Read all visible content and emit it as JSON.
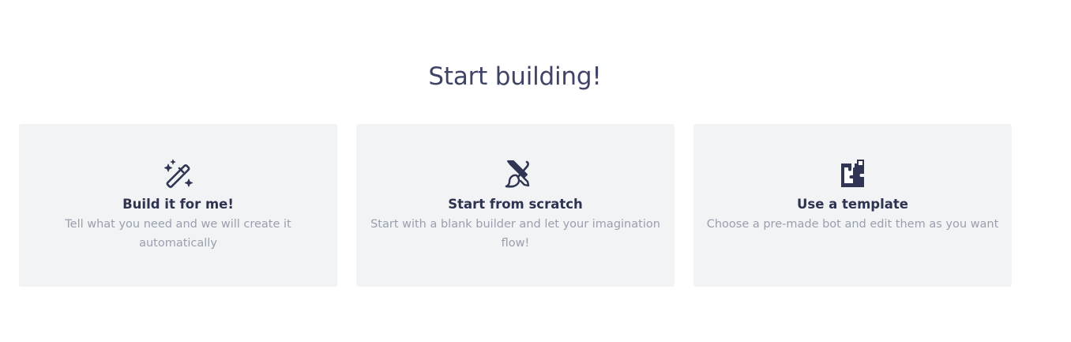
{
  "heading": "Start building!",
  "colors": {
    "heading": "#3f4466",
    "card_background": "#f2f3f5",
    "card_title": "#2e3450",
    "card_description": "#9a9fae",
    "icon": "#2f3552"
  },
  "cards": [
    {
      "icon": "magic-wand-sparkles-icon",
      "title": "Build it for me!",
      "description": "Tell what you need and we will create it automatically"
    },
    {
      "icon": "pencil-paintbrush-icon",
      "title": "Start from scratch",
      "description": "Start with a blank builder and let your imagination flow!"
    },
    {
      "icon": "puzzle-piece-icon",
      "title": "Use a template",
      "description": "Choose a pre-made bot and edit them as you want"
    }
  ]
}
